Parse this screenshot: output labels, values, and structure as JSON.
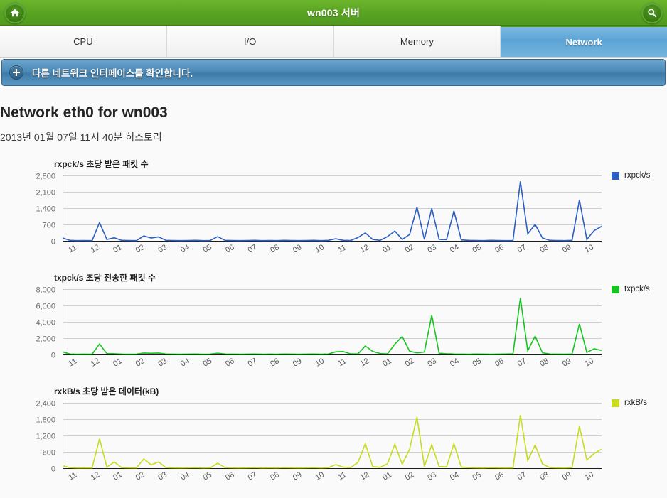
{
  "header": {
    "title": "wn003 서버",
    "home_icon": "home-icon",
    "search_icon": "search-icon",
    "bar_color": "#5aa424"
  },
  "tabs": [
    {
      "label": "CPU",
      "active": false
    },
    {
      "label": "I/O",
      "active": false
    },
    {
      "label": "Memory",
      "active": false
    },
    {
      "label": "Network",
      "active": true
    }
  ],
  "banner": {
    "label": "다른 네트워크 인터페이스를 확인합니다.",
    "icon": "plus-circle-icon",
    "color": "#4c8ab8"
  },
  "page": {
    "title": "Network eth0 for wn003",
    "subtitle": "2013년 01월 07일 11시 40분 히스토리"
  },
  "chart_data": [
    {
      "type": "line",
      "title": "rxpck/s 초당 받은 패킷 수",
      "xlabel": "",
      "ylabel": "",
      "ylim": [
        0,
        2800
      ],
      "yticks": [
        0,
        700,
        1400,
        2100,
        2800
      ],
      "ytick_labels": [
        "0",
        "700",
        "1,400",
        "2,100",
        "2,800"
      ],
      "grid": true,
      "legend_position": "right",
      "color": "#2b5fc4",
      "x": [
        "11",
        "12",
        "01",
        "02",
        "03",
        "04",
        "05",
        "06",
        "07",
        "08",
        "09",
        "10",
        "11",
        "12",
        "01",
        "02",
        "03",
        "04",
        "05",
        "06",
        "07",
        "08",
        "09",
        "10"
      ],
      "series": [
        {
          "name": "rxpck/s",
          "values": [
            120,
            20,
            10,
            15,
            10,
            780,
            60,
            130,
            20,
            15,
            10,
            210,
            120,
            170,
            20,
            15,
            10,
            15,
            20,
            10,
            15,
            180,
            20,
            15,
            10,
            15,
            20,
            10,
            15,
            10,
            20,
            15,
            10,
            15,
            20,
            10,
            20,
            90,
            20,
            15,
            140,
            340,
            60,
            20,
            180,
            420,
            60,
            270,
            1450,
            60,
            1390,
            60,
            50,
            1280,
            40,
            20,
            15,
            10,
            20,
            15,
            10,
            15,
            2550,
            300,
            700,
            120,
            20,
            15,
            10,
            20,
            1750,
            60,
            440,
            620
          ]
        }
      ]
    },
    {
      "type": "line",
      "title": "txpck/s 초당 전송한 패킷 수",
      "xlabel": "",
      "ylabel": "",
      "ylim": [
        0,
        8000
      ],
      "yticks": [
        0,
        2000,
        4000,
        6000,
        8000
      ],
      "ytick_labels": [
        "0",
        "2,000",
        "4,000",
        "6,000",
        "8,000"
      ],
      "grid": true,
      "legend_position": "right",
      "color": "#16c41f",
      "x": [
        "11",
        "12",
        "01",
        "02",
        "03",
        "04",
        "05",
        "06",
        "07",
        "08",
        "09",
        "10",
        "11",
        "12",
        "01",
        "02",
        "03",
        "04",
        "05",
        "06",
        "07",
        "08",
        "09",
        "10"
      ],
      "series": [
        {
          "name": "txpck/s",
          "values": [
            320,
            60,
            40,
            50,
            40,
            1290,
            110,
            90,
            50,
            40,
            50,
            180,
            150,
            180,
            60,
            50,
            40,
            50,
            60,
            40,
            50,
            160,
            60,
            50,
            40,
            50,
            60,
            40,
            50,
            40,
            60,
            50,
            40,
            50,
            60,
            40,
            60,
            330,
            360,
            80,
            60,
            1050,
            380,
            120,
            70,
            1270,
            2200,
            400,
            200,
            300,
            4800,
            150,
            90,
            60,
            50,
            40,
            60,
            50,
            40,
            50,
            60,
            80,
            6900,
            450,
            2250,
            200,
            60,
            50,
            40,
            60,
            3750,
            250,
            700,
            500
          ]
        }
      ]
    },
    {
      "type": "line",
      "title": "rxkB/s 초당 받은 데이터(kB)",
      "xlabel": "",
      "ylabel": "",
      "ylim": [
        0,
        2400
      ],
      "yticks": [
        0,
        600,
        1200,
        1800,
        2400
      ],
      "ytick_labels": [
        "0",
        "600",
        "1,200",
        "1,800",
        "2,400"
      ],
      "grid": true,
      "legend_position": "right",
      "color": "#c8dc1e",
      "x": [
        "11",
        "12",
        "01",
        "02",
        "03",
        "04",
        "05",
        "06",
        "07",
        "08",
        "09",
        "10",
        "11",
        "12",
        "01",
        "02",
        "03",
        "04",
        "05",
        "06",
        "07",
        "08",
        "09",
        "10"
      ],
      "series": [
        {
          "name": "rxkB/s",
          "values": [
            90,
            20,
            10,
            15,
            10,
            1080,
            40,
            230,
            20,
            15,
            10,
            340,
            120,
            230,
            20,
            15,
            10,
            15,
            20,
            10,
            15,
            180,
            20,
            15,
            10,
            15,
            20,
            10,
            15,
            10,
            20,
            15,
            10,
            15,
            20,
            10,
            20,
            130,
            40,
            20,
            210,
            900,
            60,
            30,
            160,
            880,
            140,
            700,
            1880,
            60,
            860,
            60,
            50,
            900,
            40,
            20,
            15,
            10,
            20,
            15,
            10,
            15,
            1950,
            280,
            850,
            150,
            20,
            15,
            10,
            20,
            1540,
            300,
            540,
            700
          ]
        }
      ]
    }
  ]
}
